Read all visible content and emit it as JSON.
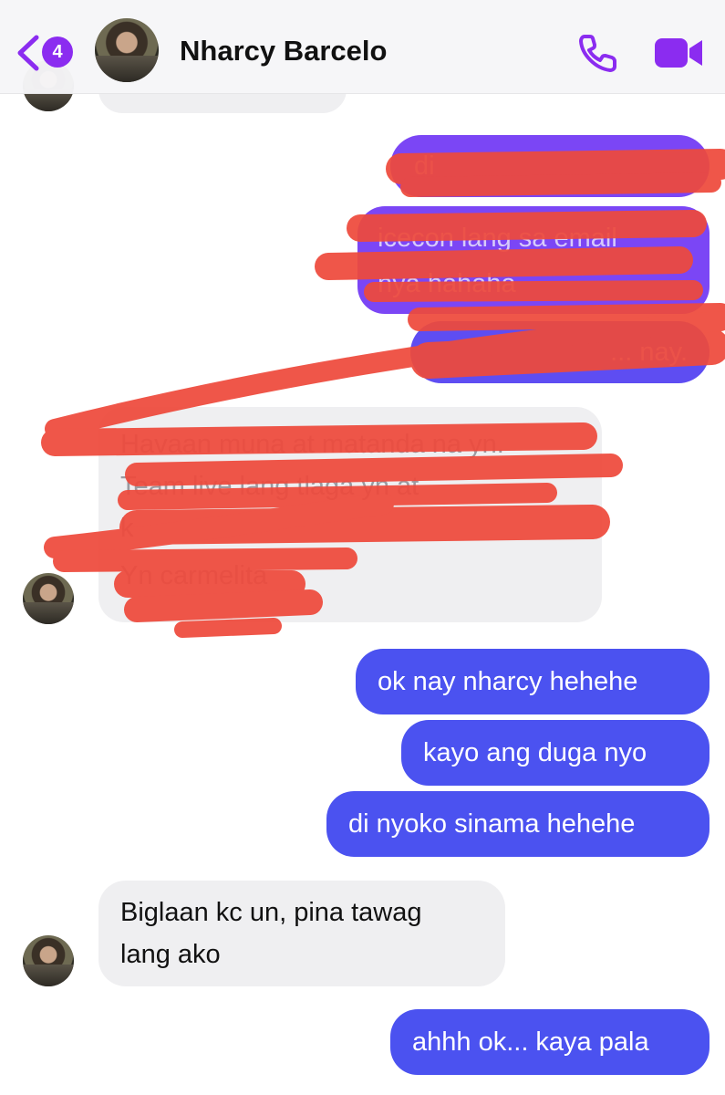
{
  "header": {
    "unread_count": "4",
    "contact_name": "Nharcy Barcelo",
    "back_icon": "chevron-left-icon",
    "call_icon": "phone-icon",
    "video_icon": "video-camera-icon",
    "accent_color": "#8b2cf0"
  },
  "redacted_messages": {
    "outgoing": [
      "di",
      "icecon lang sa email",
      "nya hahaha",
      "... nay."
    ],
    "incoming": [
      "Havaan muna at matanda na yn.",
      "Team live lang tlaga yn at",
      "k",
      "Yn carmelita"
    ]
  },
  "messages": [
    {
      "from": "me",
      "text": "ok nay nharcy hehehe"
    },
    {
      "from": "me",
      "text": "kayo ang duga nyo"
    },
    {
      "from": "me",
      "text": "di nyoko sinama hehehe"
    },
    {
      "from": "them",
      "text": "Biglaan kc un, pina tawag"
    },
    {
      "from": "them",
      "text": "lang ako"
    },
    {
      "from": "me",
      "text": "ahhh ok... kaya pala"
    }
  ],
  "colors": {
    "outgoing_bubble": "#4b52f0",
    "incoming_bubble": "#efeff1",
    "redaction_marker": "#ee4a3c"
  }
}
